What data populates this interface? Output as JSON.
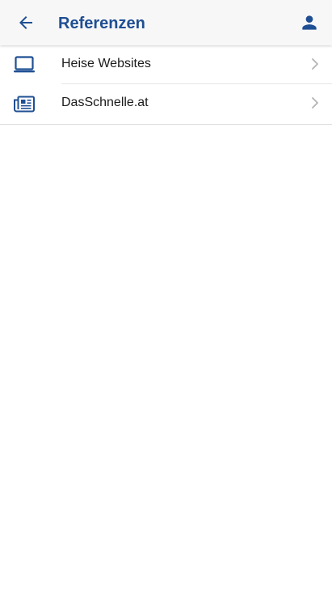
{
  "header": {
    "title": "Referenzen",
    "back_icon": "arrow-left-icon",
    "account_icon": "person-icon"
  },
  "colors": {
    "accent": "#1f4f93",
    "header_bg": "#f7f7f7",
    "chevron": "#b4b4b4",
    "text": "#1a1a1a"
  },
  "list": {
    "items": [
      {
        "label": "Heise Websites",
        "icon": "laptop-icon"
      },
      {
        "label": "DasSchnelle.at",
        "icon": "newspaper-icon"
      }
    ]
  }
}
